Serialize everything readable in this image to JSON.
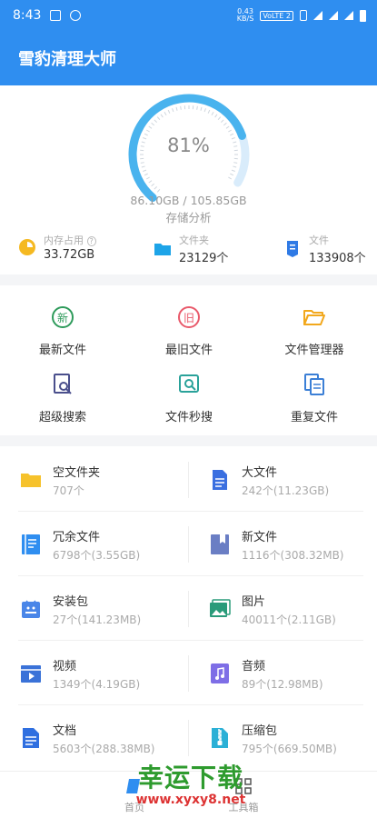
{
  "status_bar": {
    "time": "8:43",
    "net_speed_top": "0.43",
    "net_speed_bottom": "KB/S",
    "volte": "VoLTE 2"
  },
  "app_bar": {
    "title": "雪豹清理大师"
  },
  "storage": {
    "percent_used": 81,
    "percent_label": "81%",
    "usage": "86.10GB / 105.85GB",
    "analysis_label": "存储分析"
  },
  "stats": [
    {
      "label": "内存占用",
      "value": "33.72GB",
      "icon": "memory-icon",
      "help": "?"
    },
    {
      "label": "文件夹",
      "value": "23129个",
      "icon": "folder-icon"
    },
    {
      "label": "文件",
      "value": "133908个",
      "icon": "file-icon"
    }
  ],
  "tools": [
    {
      "label": "最新文件",
      "icon": "new-file-icon",
      "glyph": "新",
      "color": "#2e9b5b"
    },
    {
      "label": "最旧文件",
      "icon": "old-file-icon",
      "glyph": "旧",
      "color": "#e95a6b"
    },
    {
      "label": "文件管理器",
      "icon": "folder-manager-icon",
      "color": "#f2a81d"
    },
    {
      "label": "超级搜索",
      "icon": "super-search-icon",
      "color": "#4a4f8c"
    },
    {
      "label": "文件秒搜",
      "icon": "quick-search-icon",
      "color": "#2aa29a"
    },
    {
      "label": "重复文件",
      "icon": "duplicate-file-icon",
      "color": "#3b7fd6"
    }
  ],
  "categories": [
    {
      "name": "空文件夹",
      "count": "707个",
      "icon": "empty-folder-icon",
      "color": "#f6c22c"
    },
    {
      "name": "大文件",
      "count": "242个(11.23GB)",
      "icon": "large-file-icon",
      "color": "#3a6fe0"
    },
    {
      "name": "冗余文件",
      "count": "6798个(3.55GB)",
      "icon": "redundant-file-icon",
      "color": "#2f8ef0"
    },
    {
      "name": "新文件",
      "count": "1116个(308.32MB)",
      "icon": "new-files-icon",
      "color": "#6a7ec4"
    },
    {
      "name": "安装包",
      "count": "27个(141.23MB)",
      "icon": "apk-icon",
      "color": "#4a86e8"
    },
    {
      "name": "图片",
      "count": "40011个(2.11GB)",
      "icon": "image-icon",
      "color": "#2a9b7a"
    },
    {
      "name": "视频",
      "count": "1349个(4.19GB)",
      "icon": "video-icon",
      "color": "#3a72d8"
    },
    {
      "name": "音频",
      "count": "89个(12.98MB)",
      "icon": "audio-icon",
      "color": "#7e6ee6"
    },
    {
      "name": "文档",
      "count": "5603个(288.38MB)",
      "icon": "document-icon",
      "color": "#2f6fe0"
    },
    {
      "name": "压缩包",
      "count": "795个(669.50MB)",
      "icon": "zip-icon",
      "color": "#2bb0d6"
    }
  ],
  "bottom_nav": [
    {
      "label": "首页",
      "icon": "home-icon"
    },
    {
      "label": "工具箱",
      "icon": "apps-icon"
    }
  ],
  "watermark": {
    "line1": "幸运下载",
    "line2": "www.xyxy8.net"
  }
}
